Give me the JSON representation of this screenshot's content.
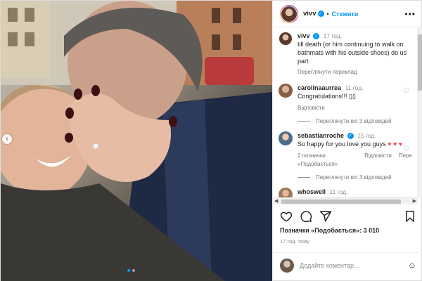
{
  "post": {
    "username": "vivv",
    "follow_label": "Стежити",
    "separator": "•",
    "more": "•••"
  },
  "caption": {
    "username": "vivv",
    "time": "17 год.",
    "text": "till death (or him continuing to walk on bathmats with his outside shoes) do us part",
    "translate_label": "Переглянути переклад"
  },
  "comments": [
    {
      "username": "carolinaaurrea",
      "time": "11 год.",
      "text": "Congratulations!!! ▯▯",
      "reply_label": "Відповісти",
      "view_replies": "Переглянути всі 3 відповідей"
    },
    {
      "username": "sebastianroche",
      "time": "15 год.",
      "text": "So happy for you love you guys",
      "hearts": "♥ ♥ ♥",
      "likes_label": "2 позначки «Подобається»",
      "reply_label": "Відповісти",
      "extra_label": "Пере",
      "view_replies": "Переглянути всі 3 відповідей"
    },
    {
      "username": "whoswell",
      "time": "11 год."
    }
  ],
  "stats": {
    "likes": "Позначки «Подобається»: 3 010",
    "ago": "17 год. тому"
  },
  "add_comment": {
    "placeholder": "Додайте коментар..."
  },
  "colors": {
    "accent": "#0095f6",
    "heart": "#ed4956"
  },
  "icons": [
    "more-icon",
    "heart-icon",
    "comment-icon",
    "share-icon",
    "save-icon",
    "emoji-icon",
    "verified-icon",
    "chevron-left-icon"
  ]
}
